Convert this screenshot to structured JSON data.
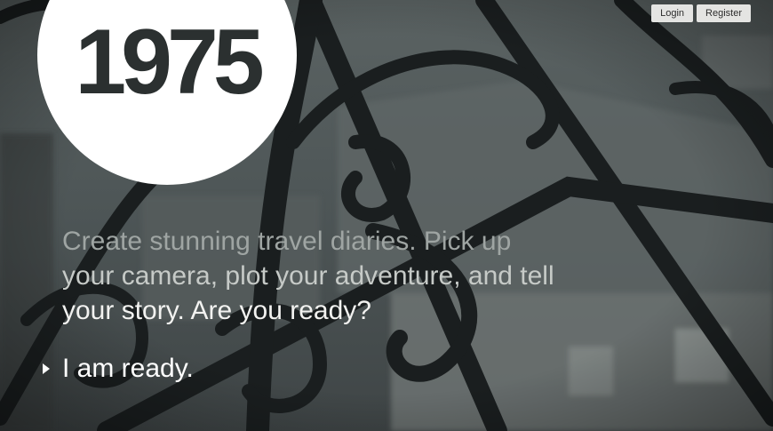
{
  "logo": {
    "text": "1975"
  },
  "header": {
    "login_label": "Login",
    "register_label": "Register"
  },
  "hero": {
    "tagline_lines": [
      "Create stunning travel diaries. Pick up",
      "your camera, plot your adventure, and tell",
      "your story. Are you ready?"
    ],
    "cta_label": "I am ready.",
    "cta_icon": "caret-right-icon"
  },
  "background": {
    "subject": "wrought-iron-gate-icon",
    "base_color": "#4a5152"
  }
}
